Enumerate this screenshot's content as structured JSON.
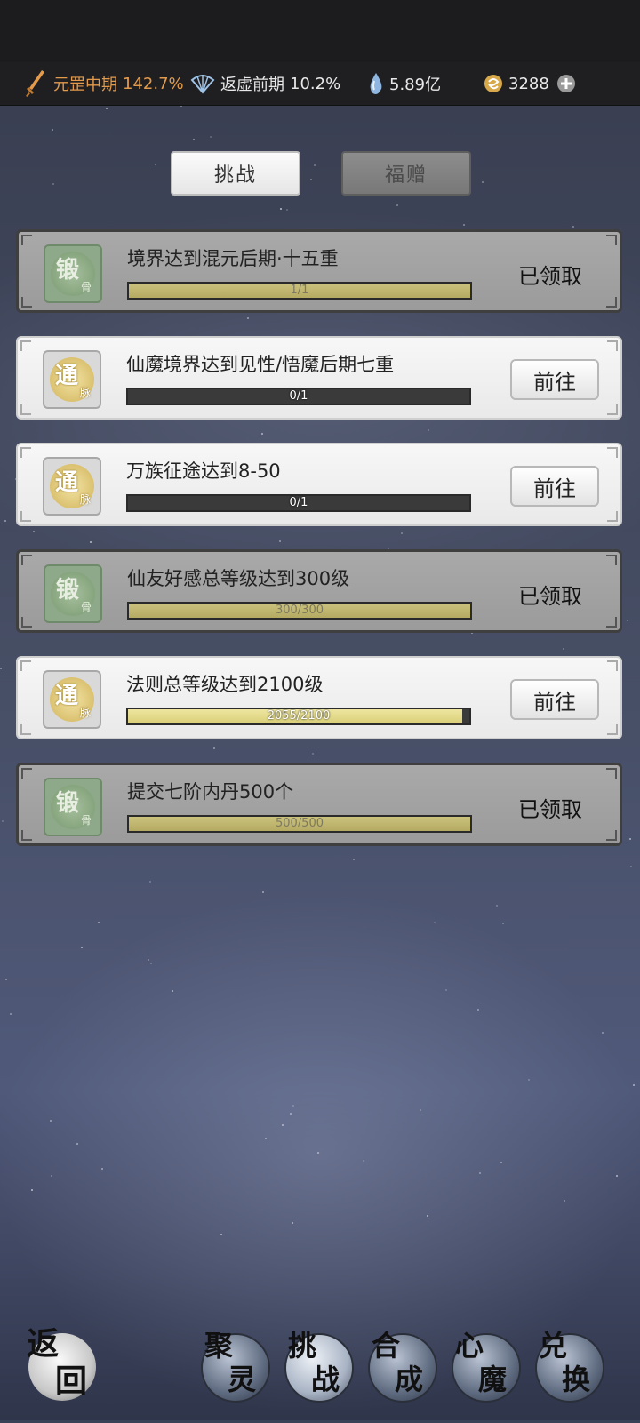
{
  "status_bar": {
    "realm_main": {
      "name": "元罡中期",
      "percent": "142.7%"
    },
    "realm_secondary": {
      "name": "返虚前期",
      "percent": "10.2%"
    },
    "spirit_stones": "5.89亿",
    "currency": "3288"
  },
  "tabs": [
    {
      "label": "挑战",
      "active": true
    },
    {
      "label": "福赠",
      "active": false
    }
  ],
  "tasks": [
    {
      "title": "境界达到混元后期·十五重",
      "progress_text": "1/1",
      "progress": 1.0,
      "state": "claimed",
      "action": "已领取",
      "icon": {
        "char": "锻",
        "sub": "骨",
        "name": "forge-bone-icon"
      }
    },
    {
      "title": "仙魔境界达到见性/悟魔后期七重",
      "progress_text": "0/1",
      "progress": 0.0,
      "state": "open",
      "action": "前往",
      "icon": {
        "char": "通",
        "sub": "脉",
        "name": "meridian-icon"
      }
    },
    {
      "title": "万族征途达到8-50",
      "progress_text": "0/1",
      "progress": 0.0,
      "state": "open",
      "action": "前往",
      "icon": {
        "char": "通",
        "sub": "脉",
        "name": "meridian-icon"
      }
    },
    {
      "title": "仙友好感总等级达到300级",
      "progress_text": "300/300",
      "progress": 1.0,
      "state": "claimed",
      "action": "已领取",
      "icon": {
        "char": "锻",
        "sub": "骨",
        "name": "forge-bone-icon"
      }
    },
    {
      "title": "法则总等级达到2100级",
      "progress_text": "2055/2100",
      "progress": 0.9786,
      "state": "open",
      "action": "前往",
      "icon": {
        "char": "通",
        "sub": "脉",
        "name": "meridian-icon"
      }
    },
    {
      "title": "提交七阶内丹500个",
      "progress_text": "500/500",
      "progress": 1.0,
      "state": "claimed",
      "action": "已领取",
      "icon": {
        "char": "锻",
        "sub": "骨",
        "name": "forge-bone-icon"
      }
    }
  ],
  "bottom_nav": {
    "back": {
      "line1": "返",
      "line2": "回"
    },
    "items": [
      {
        "line1": "聚",
        "line2": "灵",
        "active": false
      },
      {
        "line1": "挑",
        "line2": "战",
        "active": true
      },
      {
        "line1": "合",
        "line2": "成",
        "active": false
      },
      {
        "line1": "心",
        "line2": "魔",
        "active": false
      },
      {
        "line1": "兑",
        "line2": "换",
        "active": false
      }
    ]
  }
}
